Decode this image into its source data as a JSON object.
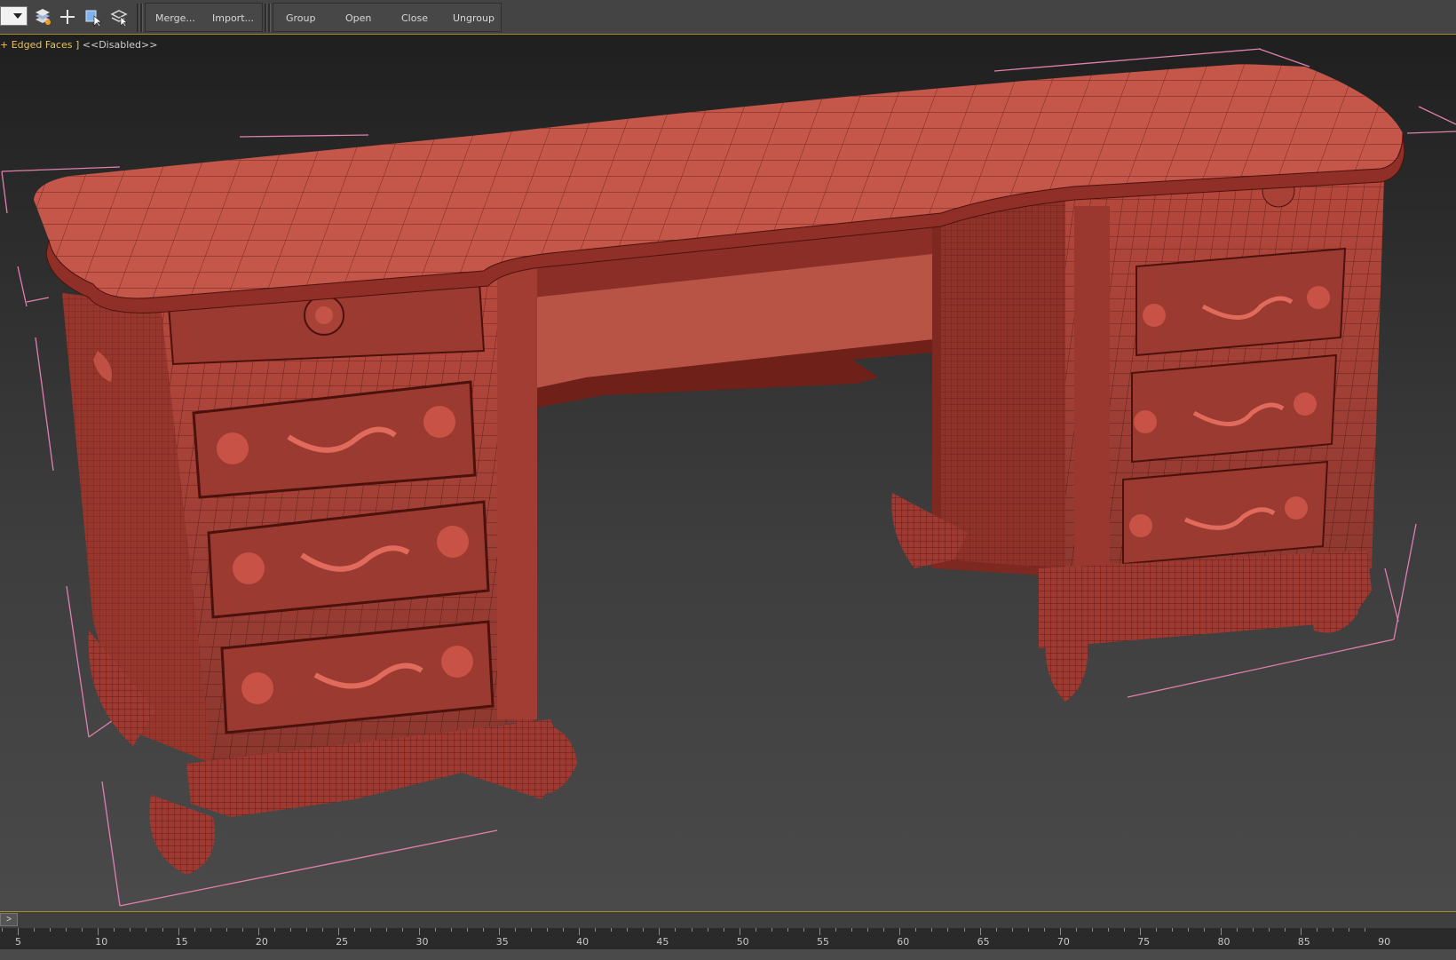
{
  "toolbar": {
    "buttons": {
      "merge": "Merge...",
      "import": "Import...",
      "group": "Group",
      "open": "Open",
      "close": "Close",
      "ungroup": "Ungroup"
    }
  },
  "viewport": {
    "shading_mode": "+ Edged Faces ]",
    "status": "<<Disabled>>",
    "object": "ornate carved vanity desk with two drawer pedestals",
    "object_color": "#b8493e",
    "bounding_box_color": "#e07fb0"
  },
  "timeline": {
    "slider_label": ">",
    "ticks": [
      "5",
      "10",
      "15",
      "20",
      "25",
      "30",
      "35",
      "40",
      "45",
      "50",
      "55",
      "60",
      "65",
      "70",
      "75",
      "80",
      "85",
      "90"
    ]
  },
  "colors": {
    "accent": "#a8892c",
    "toolbar_bg": "#444444"
  }
}
